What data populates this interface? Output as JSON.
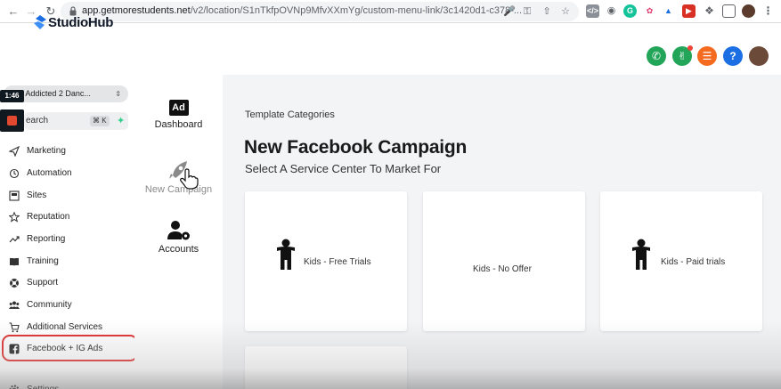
{
  "browser": {
    "url_host": "app.getmorestudents.net",
    "url_path": "/v2/location/S1nTkfpOVNp9MfvXXmYg/custom-menu-link/3c1420d1-c378-..."
  },
  "app": {
    "logo_text": "StudioHub"
  },
  "sidebar": {
    "location_name": "| Addicted 2 Danc...",
    "timer": "1:46",
    "search_placeholder": "earch",
    "search_shortcut": "⌘ K",
    "items": [
      {
        "label": "Marketing",
        "icon": "send-icon"
      },
      {
        "label": "Automation",
        "icon": "automation-icon"
      },
      {
        "label": "Sites",
        "icon": "sites-icon"
      },
      {
        "label": "Reputation",
        "icon": "star-icon"
      },
      {
        "label": "Reporting",
        "icon": "trend-icon"
      },
      {
        "label": "Training",
        "icon": "book-icon"
      },
      {
        "label": "Support",
        "icon": "lifebuoy-icon"
      },
      {
        "label": "Community",
        "icon": "people-icon"
      },
      {
        "label": "Additional Services",
        "icon": "cart-icon"
      },
      {
        "label": "Facebook + IG Ads",
        "icon": "facebook-icon"
      },
      {
        "label": "Settings",
        "icon": "gear-icon"
      }
    ]
  },
  "menu": {
    "dashboard": {
      "label": "Dashboard",
      "icon_text": "Ad"
    },
    "new_campaign": {
      "label": "New Campaign"
    },
    "accounts": {
      "label": "Accounts"
    }
  },
  "main": {
    "section_label": "Template Categories",
    "title": "New Facebook Campaign",
    "subtitle": "Select A Service Center To Market For",
    "cards": [
      {
        "label": "Kids - Free Trials",
        "has_icon": true
      },
      {
        "label": "Kids - No Offer",
        "has_icon": false
      },
      {
        "label": "Kids - Paid trials",
        "has_icon": true
      }
    ]
  },
  "colors": {
    "call": "#22a559",
    "announce": "#22a559",
    "list": "#f46a1f",
    "help": "#1b6fe3",
    "highlight": "#e02a2a",
    "brand": "#1b6fe3"
  }
}
